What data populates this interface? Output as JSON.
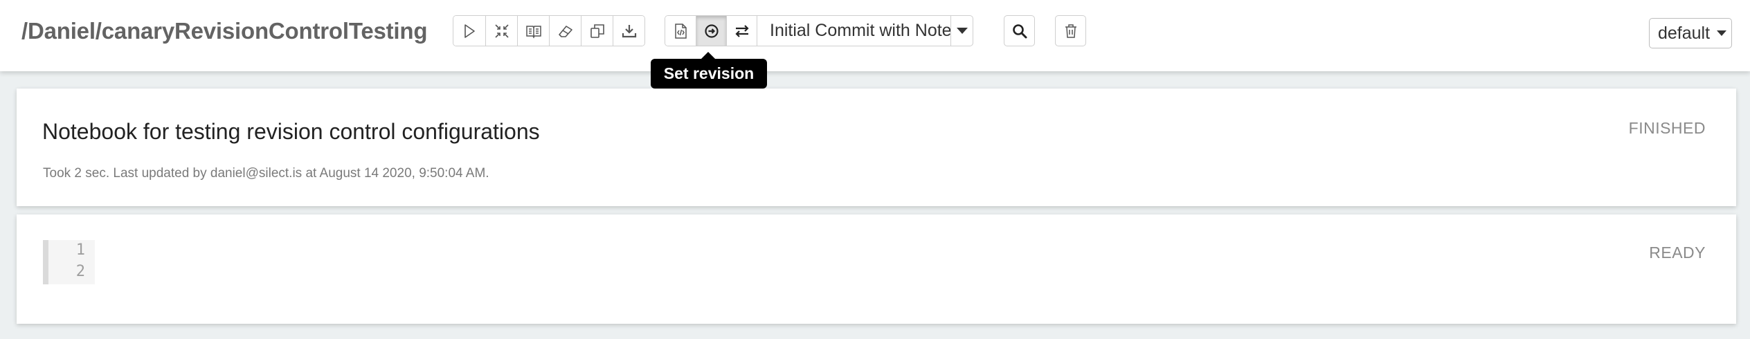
{
  "header": {
    "notebook_path": "/Daniel/canaryRevisionControlTesting",
    "toolbar_icons": [
      "run-all-icon",
      "hide-code-icon",
      "hide-output-icon",
      "clear-output-icon",
      "clone-icon",
      "export-icon"
    ],
    "revision_icons": [
      "version-control-icon",
      "set-revision-icon",
      "compare-revisions-icon"
    ],
    "revision_selected": "Initial Commit with Note",
    "search_icon": "search-icon",
    "trash_icon": "trash-icon",
    "interpreter_binding": "default"
  },
  "tooltip": {
    "text": "Set revision"
  },
  "paragraphs": [
    {
      "title": "Notebook for testing revision control configurations",
      "meta": "Took 2 sec. Last updated by daniel@silect.is at August 14 2020, 9:50:04 AM.",
      "status": "FINISHED"
    },
    {
      "line_numbers": [
        "1",
        "2"
      ],
      "status": "READY"
    }
  ]
}
